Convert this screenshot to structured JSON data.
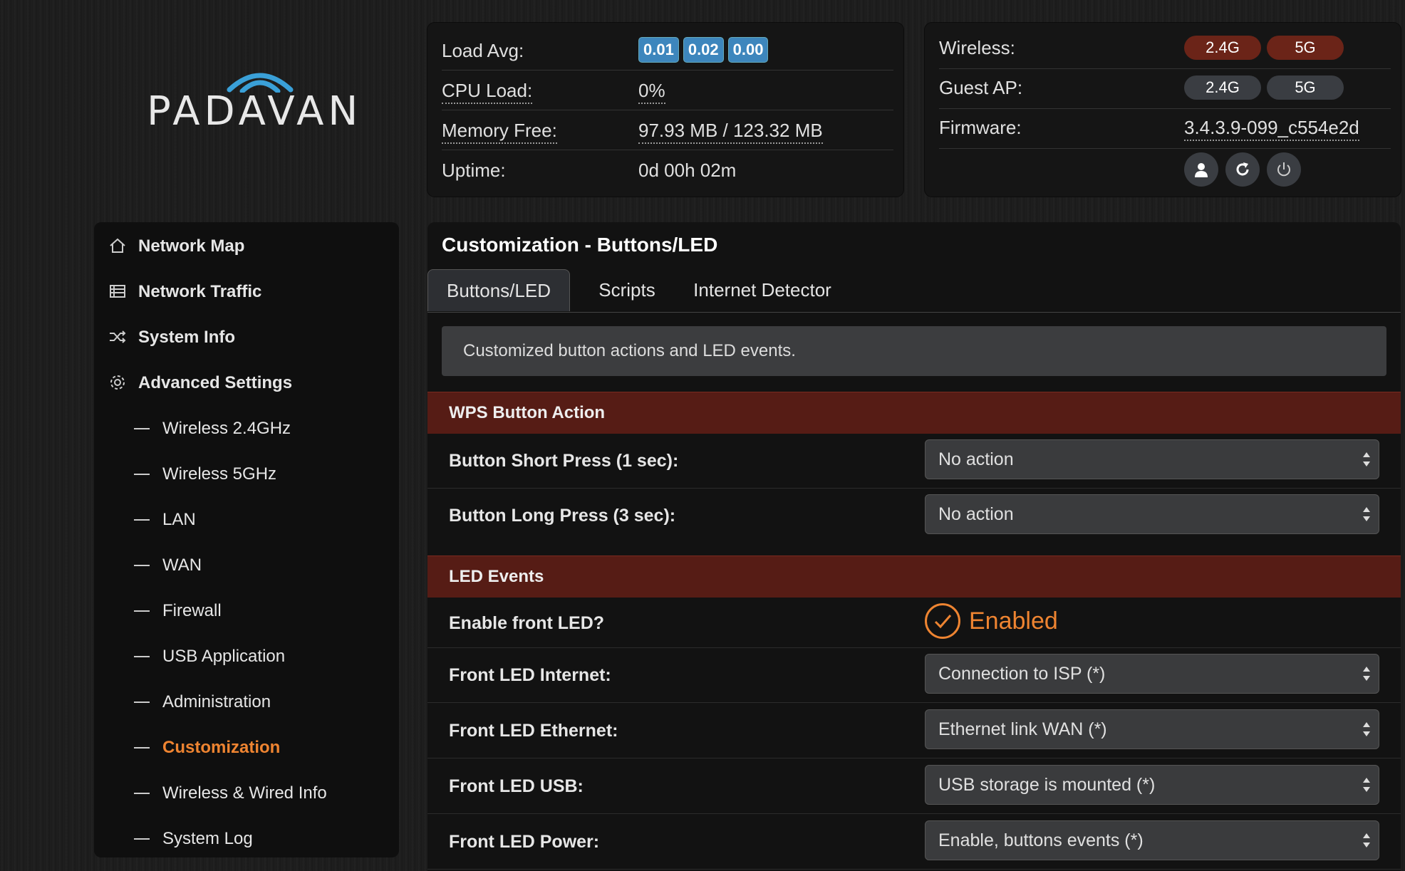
{
  "logo": {
    "text": "PADAVAN"
  },
  "status": {
    "load_label": "Load Avg:",
    "load": [
      "0.01",
      "0.02",
      "0.00"
    ],
    "cpu_label": "CPU Load:",
    "cpu": "0%",
    "mem_label": "Memory Free:",
    "mem": "97.93 MB / 123.32 MB",
    "uptime_label": "Uptime:",
    "uptime": "0d 00h 02m",
    "wireless_label": "Wireless:",
    "wireless": [
      "2.4G",
      "5G"
    ],
    "guest_label": "Guest AP:",
    "guest": [
      "2.4G",
      "5G"
    ],
    "firmware_label": "Firmware:",
    "firmware": "3.4.3.9-099_c554e2d",
    "icons": [
      "user-icon",
      "refresh-icon",
      "power-icon"
    ]
  },
  "sidebar": {
    "main": [
      {
        "label": "Network Map",
        "icon": "home-icon"
      },
      {
        "label": "Network Traffic",
        "icon": "list-icon"
      },
      {
        "label": "System Info",
        "icon": "shuffle-icon"
      },
      {
        "label": "Advanced Settings",
        "icon": "gear-icon"
      }
    ],
    "sub": [
      {
        "label": "Wireless 2.4GHz"
      },
      {
        "label": "Wireless 5GHz"
      },
      {
        "label": "LAN"
      },
      {
        "label": "WAN"
      },
      {
        "label": "Firewall"
      },
      {
        "label": "USB Application"
      },
      {
        "label": "Administration"
      },
      {
        "label": "Customization",
        "active": true
      },
      {
        "label": "Wireless & Wired Info"
      },
      {
        "label": "System Log"
      }
    ]
  },
  "main": {
    "title": "Customization - Buttons/LED",
    "tabs": [
      {
        "label": "Buttons/LED",
        "active": true
      },
      {
        "label": "Scripts"
      },
      {
        "label": "Internet Detector"
      }
    ],
    "info": "Customized button actions and LED events.",
    "wps_section": "WPS Button Action",
    "short_label": "Button Short Press (1 sec):",
    "short_value": "No action",
    "long_label": "Button Long Press (3 sec):",
    "long_value": "No action",
    "led_section": "LED Events",
    "front_led_label": "Enable front LED?",
    "front_led_value": "Enabled",
    "internet_label": "Front LED Internet:",
    "internet_value": "Connection to ISP (*)",
    "ethernet_label": "Front LED Ethernet:",
    "ethernet_value": "Ethernet link WAN (*)",
    "usb_label": "Front LED USB:",
    "usb_value": "USB storage is mounted (*)",
    "power_label": "Front LED Power:",
    "power_value": "Enable, buttons events (*)"
  },
  "colors": {
    "accent": "#ee8431",
    "section": "#561c15",
    "badge": "#3d86bd",
    "pill_active": "#6b2418"
  }
}
